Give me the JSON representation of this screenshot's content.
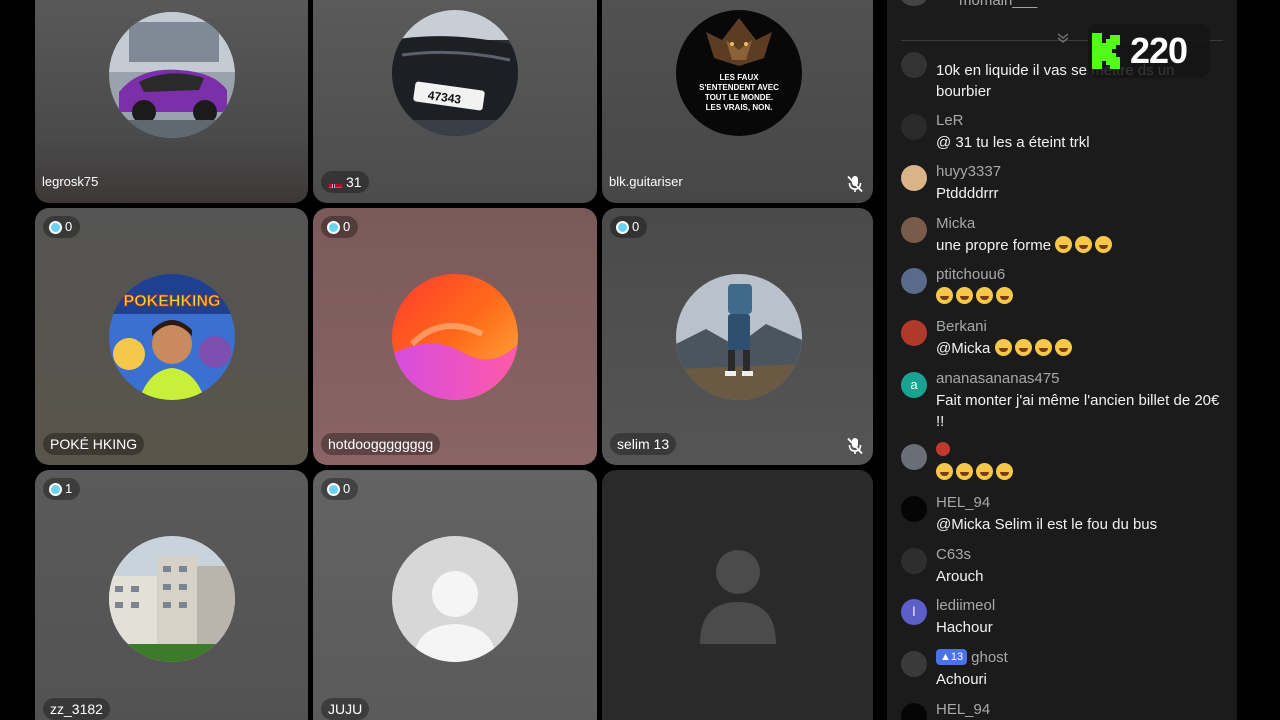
{
  "tiles": [
    {
      "name": "legrosk75"
    },
    {
      "name": "31",
      "flag": "norway"
    },
    {
      "name": "blk.guitariser",
      "muted": true,
      "avatar_text": [
        "LES FAUX",
        "S'ENTENDENT AVEC",
        "TOUT LE MONDE.",
        "LES VRAIS, NON."
      ]
    },
    {
      "name": "POKÉ HKING",
      "badge": "0",
      "avatar_text": "POKEHKING"
    },
    {
      "name": "hotdoogggggggg",
      "badge": "0"
    },
    {
      "name": "selim 13",
      "badge": "0",
      "muted": true
    },
    {
      "name": "zz_3182",
      "badge": "1"
    },
    {
      "name": "JUJU",
      "badge": "0"
    },
    {
      "name": ""
    }
  ],
  "chat": {
    "top_user": "momain___",
    "messages": [
      {
        "user": "",
        "text": "10k en liquide il vas se mettre ds un bourbier"
      },
      {
        "user": "LeR",
        "text": "@ 31 tu les a éteint trkl",
        "flag": "norway"
      },
      {
        "user": "huyy3337",
        "text": "Ptddddrrr"
      },
      {
        "user": "Micka",
        "text": "une propre forme",
        "emoji_count": 3
      },
      {
        "user": "ptitchouu6",
        "text": "",
        "emoji_count": 4
      },
      {
        "user": "Berkani",
        "text": "@Micka",
        "emoji_count": 4
      },
      {
        "user": "ananasananas475",
        "text": "Fait monter j'ai même l'ancien billet de 20€ !!",
        "initial": "a"
      },
      {
        "user": "",
        "text": "",
        "emoji_count": 4
      },
      {
        "user": "HEL_94",
        "text": "@Micka Selim il est le fou du bus"
      },
      {
        "user": "C63s",
        "text": "Arouch"
      },
      {
        "user": "lediimeol",
        "text": "Hachour",
        "initial": "l"
      },
      {
        "user": "ghost",
        "text": "Achouri",
        "level": "13"
      },
      {
        "user": "HEL_94",
        "text": ""
      }
    ]
  },
  "viewer_count": "220",
  "colors": {
    "kick_green": "#53fc18",
    "chat_bg": "#1b1b1b",
    "badge_gem": "#68d4f0"
  }
}
